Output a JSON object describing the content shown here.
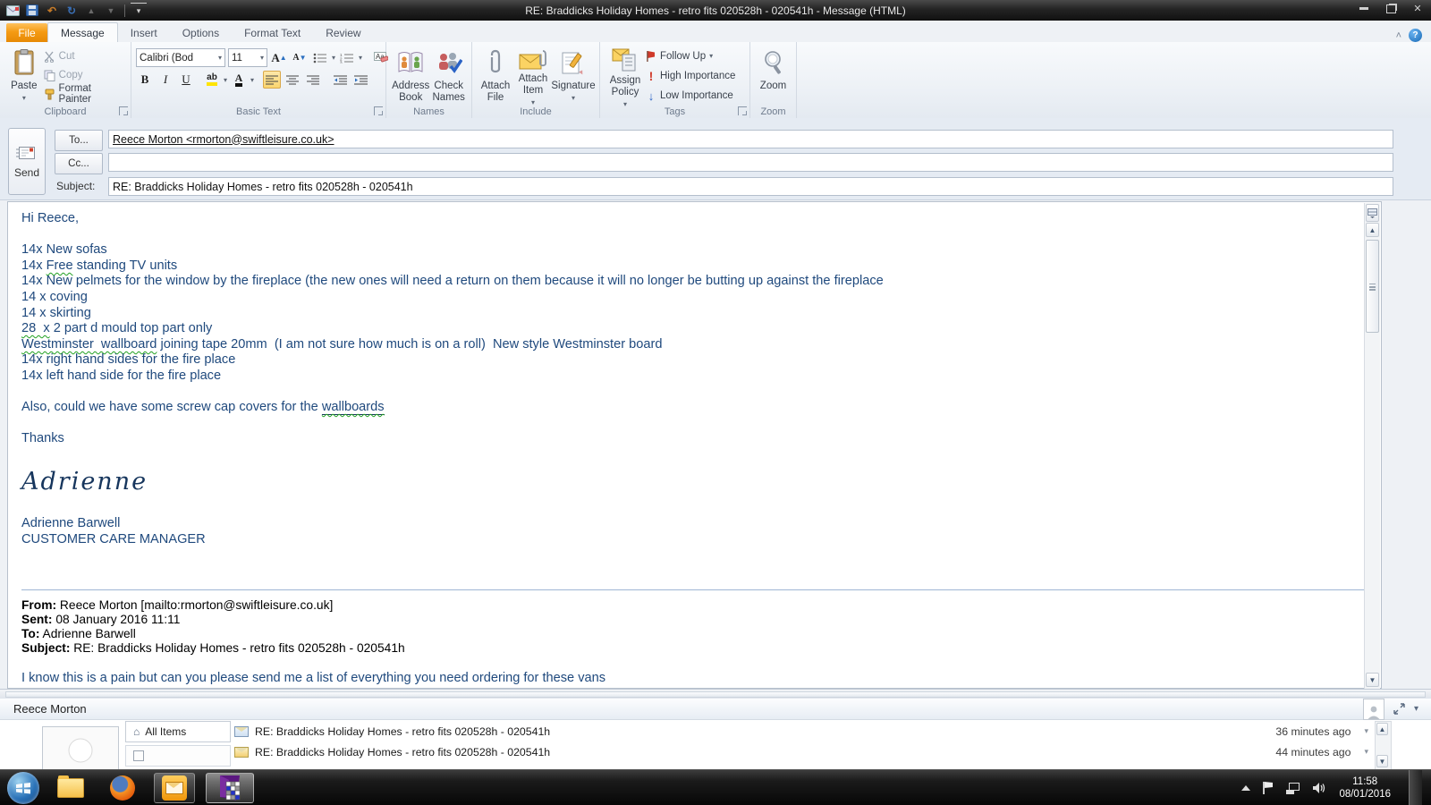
{
  "window": {
    "title": "RE: Braddicks Holiday Homes - retro fits 020528h - 020541h  -  Message (HTML)"
  },
  "icons": {
    "caret_down": "▾",
    "chevron_collapse": "˄",
    "help": "?",
    "scroll_up": "▲",
    "scroll_down": "▼",
    "home": "⌂",
    "undo": "↶",
    "redo": "↻",
    "qat_up": "▲",
    "qat_down": "▼",
    "close": "✕",
    "high_importance_mark": "!",
    "low_importance_arrow": "↓"
  },
  "tabs": [
    "File",
    "Message",
    "Insert",
    "Options",
    "Format Text",
    "Review"
  ],
  "ribbon": {
    "clipboard": {
      "label": "Clipboard",
      "paste": "Paste",
      "cut": "Cut",
      "copy": "Copy",
      "format_painter": "Format Painter"
    },
    "basic_text": {
      "label": "Basic Text",
      "font_name": "Calibri (Bod",
      "font_size": "11",
      "bold": "B",
      "italic": "I",
      "underline": "U",
      "highlight": "ab",
      "font_color": "A"
    },
    "names": {
      "label": "Names",
      "address_book": "Address Book",
      "check_names": "Check Names"
    },
    "include": {
      "label": "Include",
      "attach_file": "Attach File",
      "attach_item": "Attach Item",
      "signature": "Signature"
    },
    "tags": {
      "label": "Tags",
      "assign_policy": "Assign Policy",
      "follow_up": "Follow Up",
      "high_importance": "High Importance",
      "low_importance": "Low Importance"
    },
    "zoom": {
      "label": "Zoom",
      "button": "Zoom"
    }
  },
  "envelope": {
    "send": "Send",
    "to_button": "To...",
    "cc_button": "Cc...",
    "subject_label": "Subject:",
    "to_value": "Reece Morton <rmorton@swiftleisure.co.uk>",
    "cc_value": "",
    "subject_value": "RE: Braddicks Holiday Homes - retro fits 020528h - 020541h"
  },
  "body": {
    "text_color": "#1F497D",
    "squiggle_color": "#21a121",
    "lines": [
      {
        "segs": [
          {
            "t": "Hi Reece,"
          }
        ]
      },
      {},
      {
        "segs": [
          {
            "t": "14x New sofas"
          }
        ]
      },
      {
        "segs": [
          {
            "t": "14x "
          },
          {
            "t": "Free",
            "cls": "sq"
          },
          {
            "t": " standing TV units"
          }
        ]
      },
      {
        "segs": [
          {
            "t": "14x New pelmets for the window by the fireplace (the new ones will need a return on them because it will no longer be butting up against the fireplace"
          }
        ]
      },
      {
        "segs": [
          {
            "t": "14 x coving"
          }
        ]
      },
      {
        "segs": [
          {
            "t": "14 x skirting"
          }
        ]
      },
      {
        "segs": [
          {
            "t": "28  x",
            "cls": "sq"
          },
          {
            "t": " 2 part d mould top part only"
          }
        ]
      },
      {
        "segs": [
          {
            "t": "Westminster  wallboard",
            "cls": "sq"
          },
          {
            "t": " joining tape 20mm  (I am not sure how much is on a roll)  New style Westminster board"
          }
        ]
      },
      {
        "segs": [
          {
            "t": "14x right hand sides for the fire place"
          }
        ]
      },
      {
        "segs": [
          {
            "t": "14x left hand side for the fire place"
          }
        ]
      },
      {},
      {
        "segs": [
          {
            "t": "Also, could we have some screw cap covers for the "
          },
          {
            "t": "wallboards",
            "cls": "usq"
          }
        ]
      },
      {},
      {
        "segs": [
          {
            "t": "Thanks"
          }
        ]
      },
      {},
      {
        "style": "script",
        "segs": [
          {
            "t": "Adrienne"
          }
        ]
      },
      {},
      {
        "segs": [
          {
            "t": "Adrienne Barwell"
          }
        ]
      },
      {
        "segs": [
          {
            "t": "CUSTOMER CARE MANAGER"
          }
        ]
      },
      {},
      {},
      {
        "style": "rule"
      },
      {
        "style": "black",
        "segs": [
          {
            "t": "From:",
            "cls": "b"
          },
          {
            "t": " Reece Morton [mailto:rmorton@swiftleisure.co.uk]"
          }
        ]
      },
      {
        "style": "black",
        "segs": [
          {
            "t": "Sent:",
            "cls": "b"
          },
          {
            "t": " 08 January 2016 11:11"
          }
        ]
      },
      {
        "style": "black",
        "segs": [
          {
            "t": "To:",
            "cls": "b"
          },
          {
            "t": " Adrienne Barwell"
          }
        ]
      },
      {
        "style": "black",
        "segs": [
          {
            "t": "Subject:",
            "cls": "b"
          },
          {
            "t": " RE: Braddicks Holiday Homes - retro fits 020528h - 020541h"
          }
        ]
      },
      {},
      {
        "segs": [
          {
            "t": "I know this is a pain but can you please send me a list of everything you need ordering for these vans"
          }
        ]
      }
    ]
  },
  "people_pane": {
    "name": "Reece Morton",
    "tab_all_items": "All Items",
    "items": [
      {
        "subject": "RE: Braddicks Holiday Homes - retro fits 020528h - 020541h",
        "time": "36 minutes ago"
      },
      {
        "subject": "RE: Braddicks Holiday Homes - retro fits 020528h - 020541h",
        "time": "44 minutes ago"
      }
    ]
  },
  "taskbar": {
    "time": "11:58",
    "date": "08/01/2016"
  }
}
